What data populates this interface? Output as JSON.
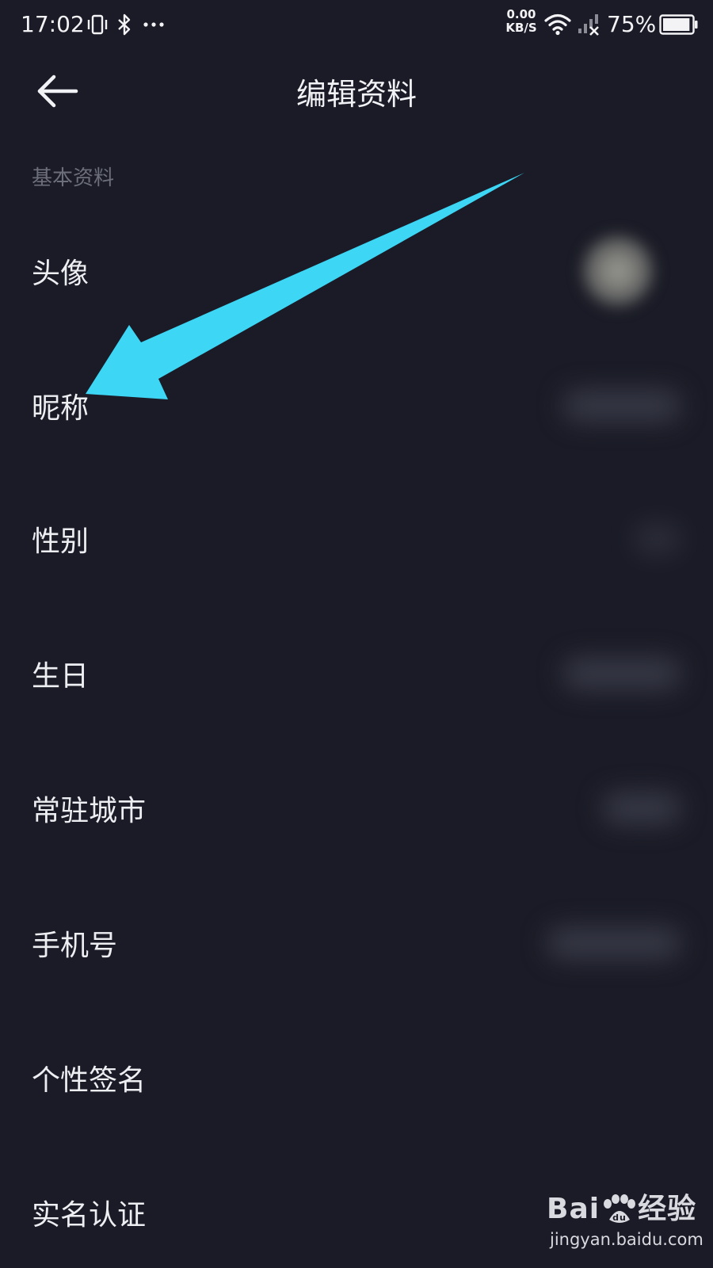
{
  "status_bar": {
    "time": "17:02",
    "net_speed_value": "0.00",
    "net_speed_unit": "KB/S",
    "battery_percent": "75%",
    "battery_level": 0.95,
    "icons": [
      "vibrate-icon",
      "bluetooth-icon",
      "more-dots-icon",
      "wifi-icon",
      "signal-icon",
      "battery-icon"
    ]
  },
  "header": {
    "title": "编辑资料",
    "back_icon": "back-arrow-icon"
  },
  "section": {
    "label": "基本资料"
  },
  "rows": [
    {
      "label": "头像"
    },
    {
      "label": "昵称"
    },
    {
      "label": "性别"
    },
    {
      "label": "生日"
    },
    {
      "label": "常驻城市"
    },
    {
      "label": "手机号"
    },
    {
      "label": "个性签名"
    },
    {
      "label": "实名认证"
    }
  ],
  "annotation": {
    "arrow_color": "#3dd6f5"
  },
  "watermark": {
    "brand_left": "Bai",
    "brand_right": "经验",
    "url": "jingyan.baidu.com"
  },
  "colors": {
    "background": "#1a1b26",
    "text_primary": "#eceef2",
    "text_secondary": "#6c6e7a"
  }
}
